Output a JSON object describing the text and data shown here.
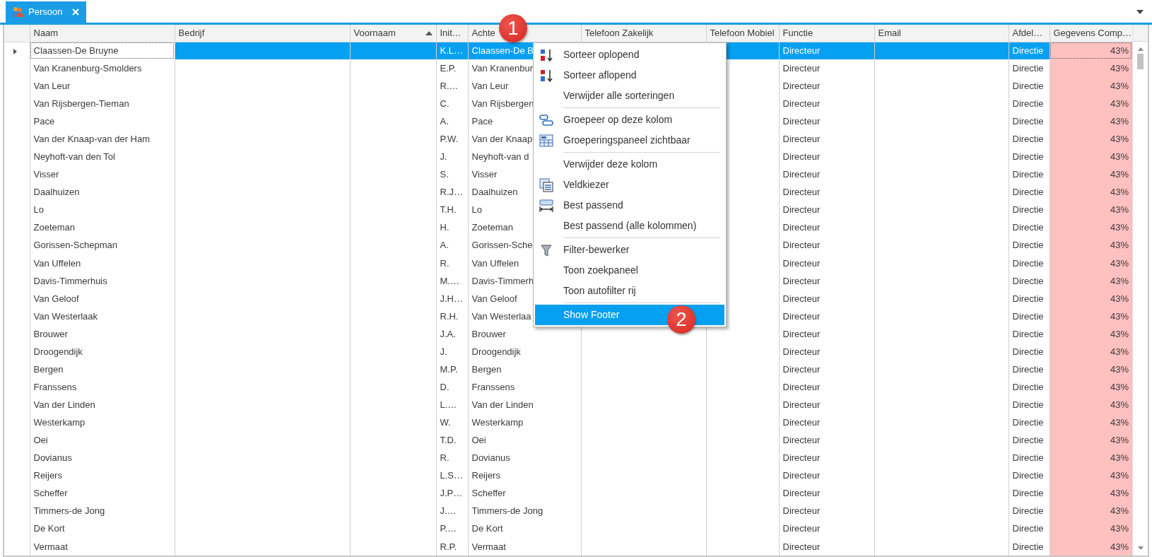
{
  "tab": {
    "label": "Persoon",
    "selected": true
  },
  "columns": [
    {
      "label": "Naam"
    },
    {
      "label": "Bedrijf"
    },
    {
      "label": "Voornaam",
      "sorted_ascending": true
    },
    {
      "label": "Init…"
    },
    {
      "label": "Achte"
    },
    {
      "label": "Telefoon Zakelijk"
    },
    {
      "label": "Telefoon Mobiel"
    },
    {
      "label": "Functie"
    },
    {
      "label": "Email"
    },
    {
      "label": "Afdel…"
    },
    {
      "label": "Gegevens Comp…"
    }
  ],
  "rows": [
    {
      "selected": true,
      "naam": "Claassen-De Bruyne",
      "initialen": "K.L…",
      "achternaam": "Claassen-De B",
      "functie": "Directeur",
      "afdeling": "Directie",
      "gegevens": "43%"
    },
    {
      "selected": false,
      "naam": "Van Kranenburg-Smolders",
      "initialen": "E.P.",
      "achternaam": "Van Kranenbur",
      "functie": "Directeur",
      "afdeling": "Directie",
      "gegevens": "43%"
    },
    {
      "selected": false,
      "naam": "Van Leur",
      "initialen": "R.…",
      "achternaam": "Van Leur",
      "functie": "Directeur",
      "afdeling": "Directie",
      "gegevens": "43%"
    },
    {
      "selected": false,
      "naam": "Van Rijsbergen-Tieman",
      "initialen": "C.",
      "achternaam": "Van Rijsbergen",
      "functie": "Directeur",
      "afdeling": "Directie",
      "gegevens": "43%"
    },
    {
      "selected": false,
      "naam": "Pace",
      "initialen": "A.",
      "achternaam": "Pace",
      "functie": "Directeur",
      "afdeling": "Directie",
      "gegevens": "43%"
    },
    {
      "selected": false,
      "naam": "Van der Knaap-van der Ham",
      "initialen": "P.W.",
      "achternaam": "Van der Knaap",
      "functie": "Directeur",
      "afdeling": "Directie",
      "gegevens": "43%"
    },
    {
      "selected": false,
      "naam": "Neyhoft-van den Tol",
      "initialen": "J.",
      "achternaam": "Neyhoft-van d",
      "functie": "Directeur",
      "afdeling": "Directie",
      "gegevens": "43%"
    },
    {
      "selected": false,
      "naam": "Visser",
      "initialen": "S.",
      "achternaam": "Visser",
      "functie": "Directeur",
      "afdeling": "Directie",
      "gegevens": "43%"
    },
    {
      "selected": false,
      "naam": "Daalhuizen",
      "initialen": "R.J…",
      "achternaam": "Daalhuizen",
      "functie": "Directeur",
      "afdeling": "Directie",
      "gegevens": "43%"
    },
    {
      "selected": false,
      "naam": "Lo",
      "initialen": "T.H.",
      "achternaam": "Lo",
      "functie": "Directeur",
      "afdeling": "Directie",
      "gegevens": "43%"
    },
    {
      "selected": false,
      "naam": "Zoeteman",
      "initialen": "H.",
      "achternaam": "Zoeteman",
      "functie": "Directeur",
      "afdeling": "Directie",
      "gegevens": "43%"
    },
    {
      "selected": false,
      "naam": "Gorissen-Schepman",
      "initialen": "A.",
      "achternaam": "Gorissen-Sche",
      "functie": "Directeur",
      "afdeling": "Directie",
      "gegevens": "43%"
    },
    {
      "selected": false,
      "naam": "Van Uffelen",
      "initialen": "R.",
      "achternaam": "Van Uffelen",
      "functie": "Directeur",
      "afdeling": "Directie",
      "gegevens": "43%"
    },
    {
      "selected": false,
      "naam": "Davis-Timmerhuis",
      "initialen": "M.…",
      "achternaam": "Davis-Timmerh",
      "functie": "Directeur",
      "afdeling": "Directie",
      "gegevens": "43%"
    },
    {
      "selected": false,
      "naam": "Van Geloof",
      "initialen": "J.H…",
      "achternaam": "Van Geloof",
      "functie": "Directeur",
      "afdeling": "Directie",
      "gegevens": "43%"
    },
    {
      "selected": false,
      "naam": "Van Westerlaak",
      "initialen": "R.H.",
      "achternaam": "Van Westerlaa",
      "functie": "Directeur",
      "afdeling": "Directie",
      "gegevens": "43%"
    },
    {
      "selected": false,
      "naam": "Brouwer",
      "initialen": "J.A.",
      "achternaam": "Brouwer",
      "functie": "Directeur",
      "afdeling": "Directie",
      "gegevens": "43%"
    },
    {
      "selected": false,
      "naam": "Droogendijk",
      "initialen": "J.",
      "achternaam": "Droogendijk",
      "functie": "Directeur",
      "afdeling": "Directie",
      "gegevens": "43%"
    },
    {
      "selected": false,
      "naam": "Bergen",
      "initialen": "M.P.",
      "achternaam": "Bergen",
      "functie": "Directeur",
      "afdeling": "Directie",
      "gegevens": "43%"
    },
    {
      "selected": false,
      "naam": "Franssens",
      "initialen": "D.",
      "achternaam": "Franssens",
      "functie": "Directeur",
      "afdeling": "Directie",
      "gegevens": "43%"
    },
    {
      "selected": false,
      "naam": "Van der Linden",
      "initialen": "L.…",
      "achternaam": "Van der Linden",
      "functie": "Directeur",
      "afdeling": "Directie",
      "gegevens": "43%"
    },
    {
      "selected": false,
      "naam": "Westerkamp",
      "initialen": "W.",
      "achternaam": "Westerkamp",
      "functie": "Directeur",
      "afdeling": "Directie",
      "gegevens": "43%"
    },
    {
      "selected": false,
      "naam": "Oei",
      "initialen": "T.D.",
      "achternaam": "Oei",
      "functie": "Directeur",
      "afdeling": "Directie",
      "gegevens": "43%"
    },
    {
      "selected": false,
      "naam": "Dovianus",
      "initialen": "R.",
      "achternaam": "Dovianus",
      "functie": "Directeur",
      "afdeling": "Directie",
      "gegevens": "43%"
    },
    {
      "selected": false,
      "naam": "Reijers",
      "initialen": "L.S…",
      "achternaam": "Reijers",
      "functie": "Directeur",
      "afdeling": "Directie",
      "gegevens": "43%"
    },
    {
      "selected": false,
      "naam": "Scheffer",
      "initialen": "J.P…",
      "achternaam": "Scheffer",
      "functie": "Directeur",
      "afdeling": "Directie",
      "gegevens": "43%"
    },
    {
      "selected": false,
      "naam": "Timmers-de Jong",
      "initialen": "J.…",
      "achternaam": "Timmers-de Jong",
      "functie": "Directeur",
      "afdeling": "Directie",
      "gegevens": "43%"
    },
    {
      "selected": false,
      "naam": "De Kort",
      "initialen": "P.…",
      "achternaam": "De Kort",
      "functie": "Directeur",
      "afdeling": "Directie",
      "gegevens": "43%"
    },
    {
      "selected": false,
      "naam": "Vermaat",
      "initialen": "R.P.",
      "achternaam": "Vermaat",
      "functie": "Directeur",
      "afdeling": "Directie",
      "gegevens": "43%"
    }
  ],
  "context_menu": [
    {
      "label": "Sorteer oplopend",
      "kind": "sort-asc",
      "selected": false
    },
    {
      "label": "Sorteer aflopend",
      "kind": "sort-desc",
      "selected": false
    },
    {
      "label": "Verwijder alle sorteringen",
      "kind": "plain",
      "selected": false
    },
    {
      "label": "Groepeer op deze kolom",
      "kind": "group",
      "separator_before": true,
      "selected": false
    },
    {
      "label": "Groeperingspaneel zichtbaar",
      "kind": "group-panel",
      "selected": false
    },
    {
      "label": "Verwijder deze kolom",
      "kind": "plain",
      "separator_before": true,
      "selected": false
    },
    {
      "label": "Veldkiezer",
      "kind": "field-chooser",
      "selected": false
    },
    {
      "label": "Best passend",
      "kind": "best-fit",
      "selected": false
    },
    {
      "label": "Best passend (alle kolommen)",
      "kind": "plain",
      "selected": false
    },
    {
      "label": "Filter-bewerker",
      "kind": "filter",
      "separator_before": true,
      "selected": false
    },
    {
      "label": "Toon zoekpaneel",
      "kind": "plain",
      "selected": false
    },
    {
      "label": "Toon autofilter rij",
      "kind": "plain",
      "selected": false
    },
    {
      "label": "Show Footer",
      "kind": "plain",
      "separator_before": true,
      "selected": true
    }
  ],
  "callouts": [
    {
      "label": "1"
    },
    {
      "label": "2"
    }
  ]
}
